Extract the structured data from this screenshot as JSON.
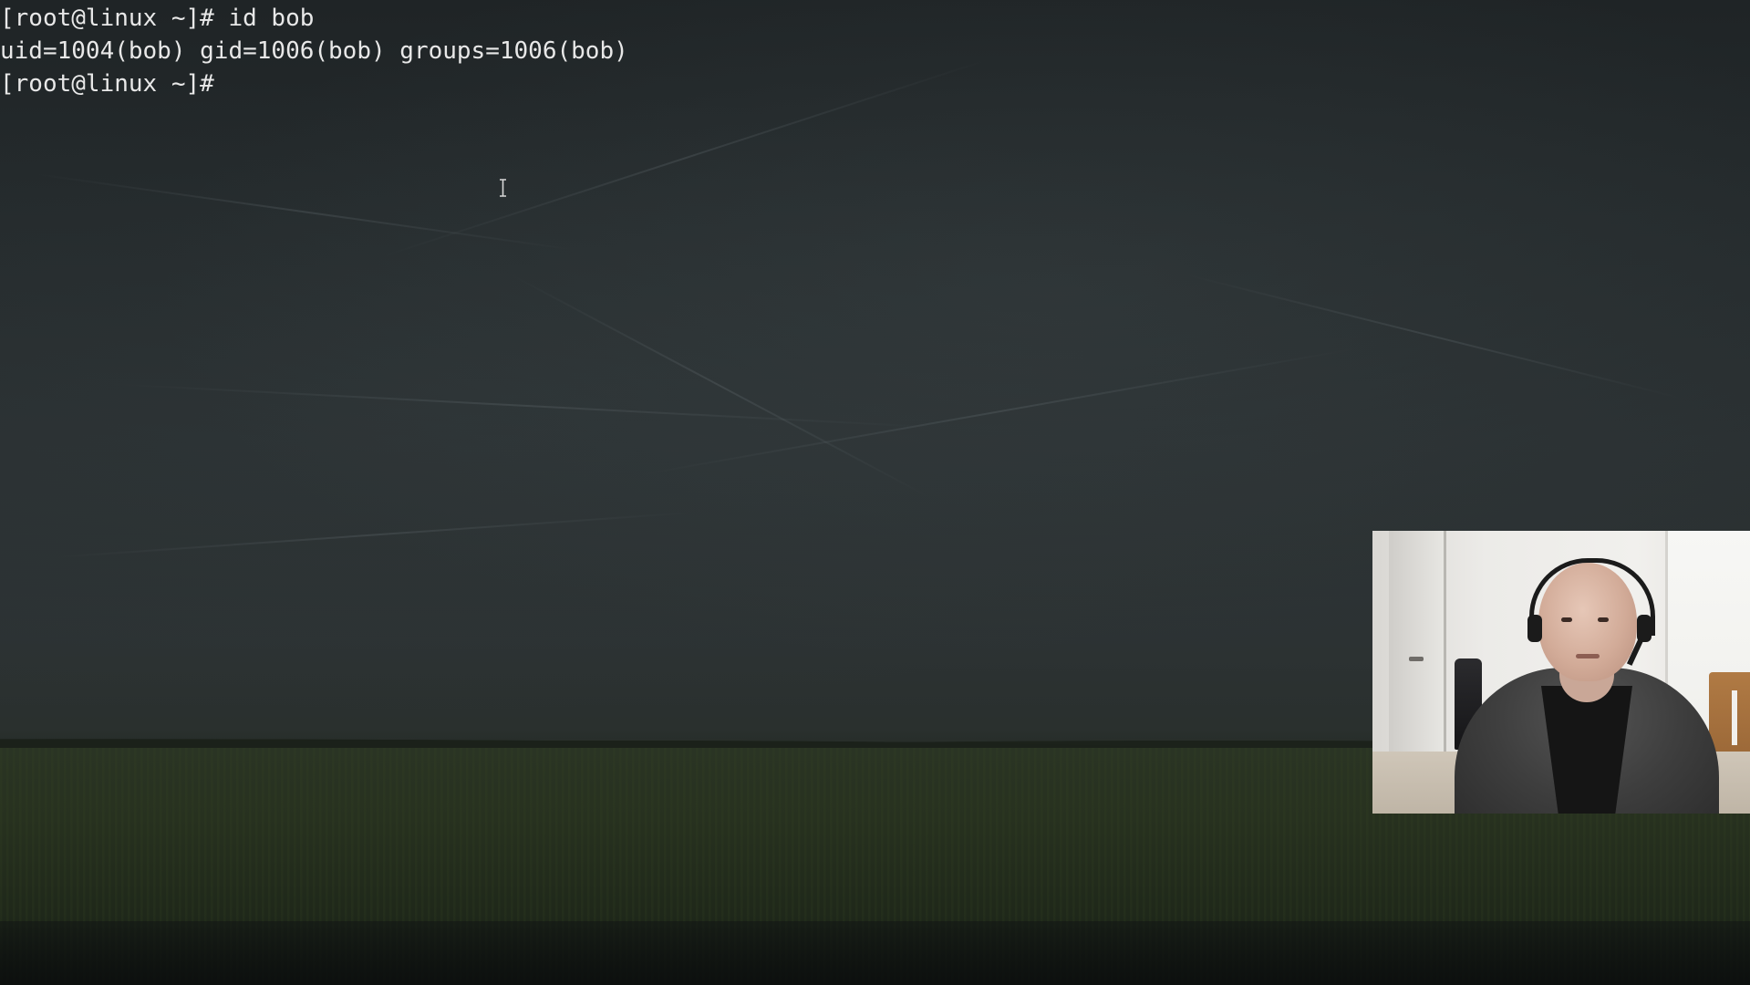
{
  "terminal": {
    "lines": [
      "[root@linux ~]# id bob",
      "uid=1004(bob) gid=1006(bob) groups=1006(bob)",
      "[root@linux ~]#"
    ]
  },
  "colors": {
    "terminal_text": "#e8e8e8",
    "background_sky": "#2a3032",
    "background_field": "#27311f"
  },
  "icons": {
    "mouse_cursor": "text-cursor-ibeam-icon"
  }
}
